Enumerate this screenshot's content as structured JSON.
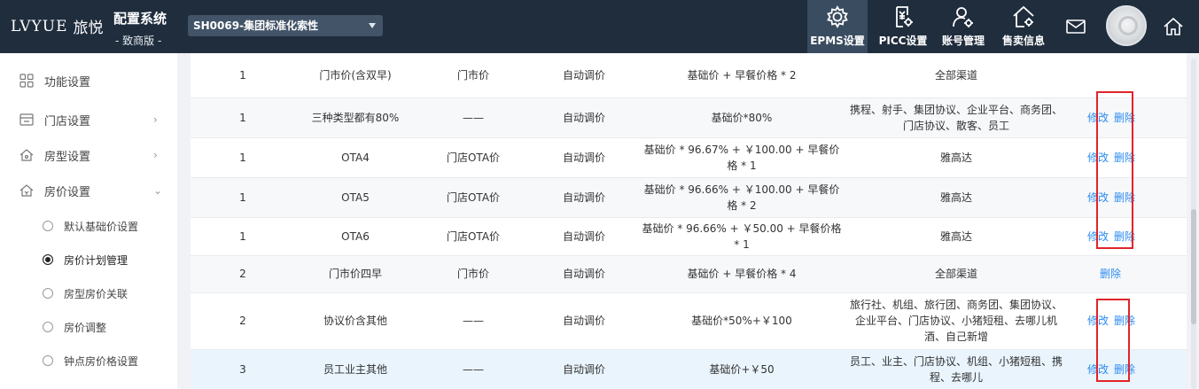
{
  "header": {
    "logo_text": "LVYUE",
    "logo_cn": "旅悦",
    "system_title": "配置系统",
    "system_subtitle": "- 致商版 -",
    "hotel_select_value": "SH0069-集团标准化索性",
    "nav": [
      {
        "label": "EPMS设置",
        "icon": "gear-icon",
        "active": true
      },
      {
        "label": "PICC设置",
        "icon": "document-gear-icon",
        "active": false
      },
      {
        "label": "账号管理",
        "icon": "user-gear-icon",
        "active": false
      },
      {
        "label": "售卖信息",
        "icon": "house-gear-icon",
        "active": false
      }
    ],
    "mail_icon": "mail-icon",
    "home_icon": "home-icon"
  },
  "sidebar": {
    "items": [
      {
        "label": "功能设置",
        "icon": "grid-icon",
        "arrow": ""
      },
      {
        "label": "门店设置",
        "icon": "store-icon",
        "arrow": "›"
      },
      {
        "label": "房型设置",
        "icon": "room-icon",
        "arrow": "›"
      },
      {
        "label": "房价设置",
        "icon": "price-icon",
        "arrow": "⌄"
      }
    ],
    "subitems": [
      {
        "label": "默认基础价设置",
        "active": false
      },
      {
        "label": "房价计划管理",
        "active": true
      },
      {
        "label": "房型房价关联",
        "active": false
      },
      {
        "label": "房价调整",
        "active": false
      },
      {
        "label": "钟点房价格设置",
        "active": false
      }
    ]
  },
  "table": {
    "rows": [
      {
        "level": "1",
        "name": "门市价(含双早)",
        "base": "门市价",
        "mode": "自动调价",
        "formula": "基础价 + 早餐价格 * 2",
        "channels": "全部渠道",
        "edit": "",
        "del": ""
      },
      {
        "level": "1",
        "name": "三种类型都有80%",
        "base": "——",
        "mode": "自动调价",
        "formula": "基础价*80%",
        "channels": "携程、射手、集团协议、企业平台、商务团、门店协议、散客、员工",
        "edit": "修改",
        "del": "删除"
      },
      {
        "level": "1",
        "name": "OTA4",
        "base": "门店OTA价",
        "mode": "自动调价",
        "formula": "基础价 * 96.67% + ￥100.00 + 早餐价格 * 1",
        "channels": "雅高达",
        "edit": "修改",
        "del": "删除"
      },
      {
        "level": "1",
        "name": "OTA5",
        "base": "门店OTA价",
        "mode": "自动调价",
        "formula": "基础价 * 96.66% + ￥100.00 + 早餐价格 * 2",
        "channels": "雅高达",
        "edit": "修改",
        "del": "删除"
      },
      {
        "level": "1",
        "name": "OTA6",
        "base": "门店OTA价",
        "mode": "自动调价",
        "formula": "基础价 * 96.66% + ￥50.00 + 早餐价格 * 1",
        "channels": "雅高达",
        "edit": "修改",
        "del": "删除"
      },
      {
        "level": "2",
        "name": "门市价四早",
        "base": "门市价",
        "mode": "自动调价",
        "formula": "基础价 + 早餐价格 * 4",
        "channels": "全部渠道",
        "edit": "",
        "del": "删除"
      },
      {
        "level": "2",
        "name": "协议价含其他",
        "base": "——",
        "mode": "自动调价",
        "formula": "基础价*50%+￥100",
        "channels": "旅行社、机组、旅行团、商务团、集团协议、企业平台、门店协议、小猪短租、去哪儿机酒、自己新增",
        "edit": "修改",
        "del": "删除"
      },
      {
        "level": "3",
        "name": "员工业主其他",
        "base": "——",
        "mode": "自动调价",
        "formula": "基础价+￥50",
        "channels": "员工、业主、门店协议、机组、小猪短租、携程、去哪儿",
        "edit": "修改",
        "del": "删除"
      }
    ]
  }
}
